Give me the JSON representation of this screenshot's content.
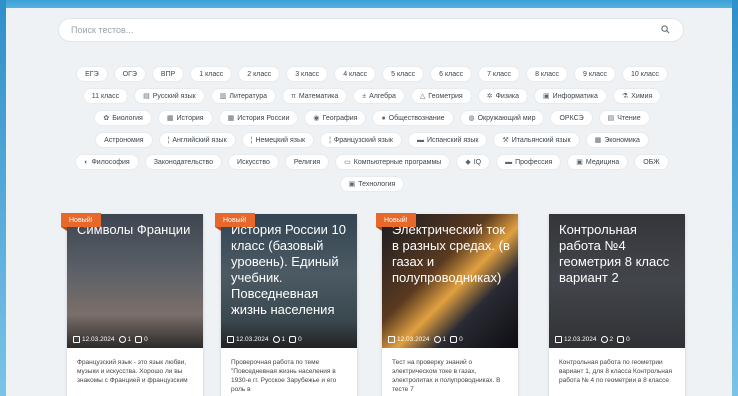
{
  "search": {
    "placeholder": "Поиск тестов..."
  },
  "tags": [
    {
      "label": "ЕГЭ",
      "icon": ""
    },
    {
      "label": "ОГЭ",
      "icon": ""
    },
    {
      "label": "ВПР",
      "icon": ""
    },
    {
      "label": "1 класс",
      "icon": ""
    },
    {
      "label": "2 класс",
      "icon": ""
    },
    {
      "label": "3 класс",
      "icon": ""
    },
    {
      "label": "4 класс",
      "icon": ""
    },
    {
      "label": "5 класс",
      "icon": ""
    },
    {
      "label": "6 класс",
      "icon": ""
    },
    {
      "label": "7 класс",
      "icon": ""
    },
    {
      "label": "8 класс",
      "icon": ""
    },
    {
      "label": "9 класс",
      "icon": ""
    },
    {
      "label": "10 класс",
      "icon": ""
    },
    {
      "label": "11 класс",
      "icon": ""
    },
    {
      "label": "Русский язык",
      "icon": "▤"
    },
    {
      "label": "Литература",
      "icon": "▥"
    },
    {
      "label": "Математика",
      "icon": "π"
    },
    {
      "label": "Алгебра",
      "icon": "±"
    },
    {
      "label": "Геометрия",
      "icon": "△"
    },
    {
      "label": "Физика",
      "icon": "✲"
    },
    {
      "label": "Информатика",
      "icon": "▣"
    },
    {
      "label": "Химия",
      "icon": "⚗"
    },
    {
      "label": "Биология",
      "icon": "✿"
    },
    {
      "label": "История",
      "icon": "▦"
    },
    {
      "label": "История России",
      "icon": "▦"
    },
    {
      "label": "География",
      "icon": "◉"
    },
    {
      "label": "Обществознание",
      "icon": "●"
    },
    {
      "label": "Окружающий мир",
      "icon": "◍"
    },
    {
      "label": "ОРКСЭ",
      "icon": ""
    },
    {
      "label": "Чтение",
      "icon": "▤"
    },
    {
      "label": "Астрономия",
      "icon": ""
    },
    {
      "label": "Английский язык",
      "icon": "¦"
    },
    {
      "label": "Немецкий язык",
      "icon": "¦"
    },
    {
      "label": "Французский язык",
      "icon": "¦"
    },
    {
      "label": "Испанский язык",
      "icon": "▬"
    },
    {
      "label": "Итальянский язык",
      "icon": "⚒"
    },
    {
      "label": "Экономика",
      "icon": "▦"
    },
    {
      "label": "Философия",
      "icon": "◐"
    },
    {
      "label": "Законодательство",
      "icon": ""
    },
    {
      "label": "Искусство",
      "icon": ""
    },
    {
      "label": "Религия",
      "icon": ""
    },
    {
      "label": "Компьютерные программы",
      "icon": "▭"
    },
    {
      "label": "IQ",
      "icon": "◆"
    },
    {
      "label": "Профессия",
      "icon": "▬"
    },
    {
      "label": "Медицина",
      "icon": "▣"
    },
    {
      "label": "ОБЖ",
      "icon": ""
    },
    {
      "label": "Технология",
      "icon": "▣"
    }
  ],
  "cards": [
    {
      "badge": "Новый!",
      "title": "Символы Франции",
      "date": "12.03.2024",
      "users": "1",
      "comments": "0",
      "desc": "Французский язык - это язык любви, музыки и искусства. Хорошо ли вы знакомы с Францией и французским",
      "bg": "linear-gradient(180deg,#3d4550 0%,#5a5f66 40%,#7a6f6a 75%,#2c2a2a 100%)"
    },
    {
      "badge": "Новый!",
      "title": "История России 10 класс (базовый уровень). Единый учебник. Повседневная жизнь населения",
      "date": "12.03.2024",
      "users": "1",
      "comments": "0",
      "desc": "Проверочная работа по теме \"Повседневная жизнь населения в 1930-е гг. Русское Зарубежье и его роль в",
      "bg": "linear-gradient(180deg,#334553 0%,#4c5a63 45%,#39474e 80%,#222 100%)"
    },
    {
      "badge": "Новый!",
      "title": "Электрический ток в разных средах. (в газах и полупроводниках)",
      "date": "12.03.2024",
      "users": "1",
      "comments": "0",
      "desc": "Тест на проверку знаний о электрическом токе в газах, электролитах и полупроводниках. В тесте 7",
      "bg": "linear-gradient(135deg,#1b1b22 0%,#5a3a20 40%,#e0a040 55%,#2a2a33 70%,#0d0d12 100%)"
    },
    {
      "badge": "",
      "title": "Контрольная работа №4 геометрия 8 класс вариант 2",
      "date": "12.03.2024",
      "users": "2",
      "comments": "0",
      "desc": "Контрольная работа по геометрии вариант 1, для 8 класса Контрольная работа № 4 по геометрии в 8 классе",
      "bg": "linear-gradient(180deg,#34363b 0%,#42454b 50%,#2f3135 100%)"
    }
  ]
}
